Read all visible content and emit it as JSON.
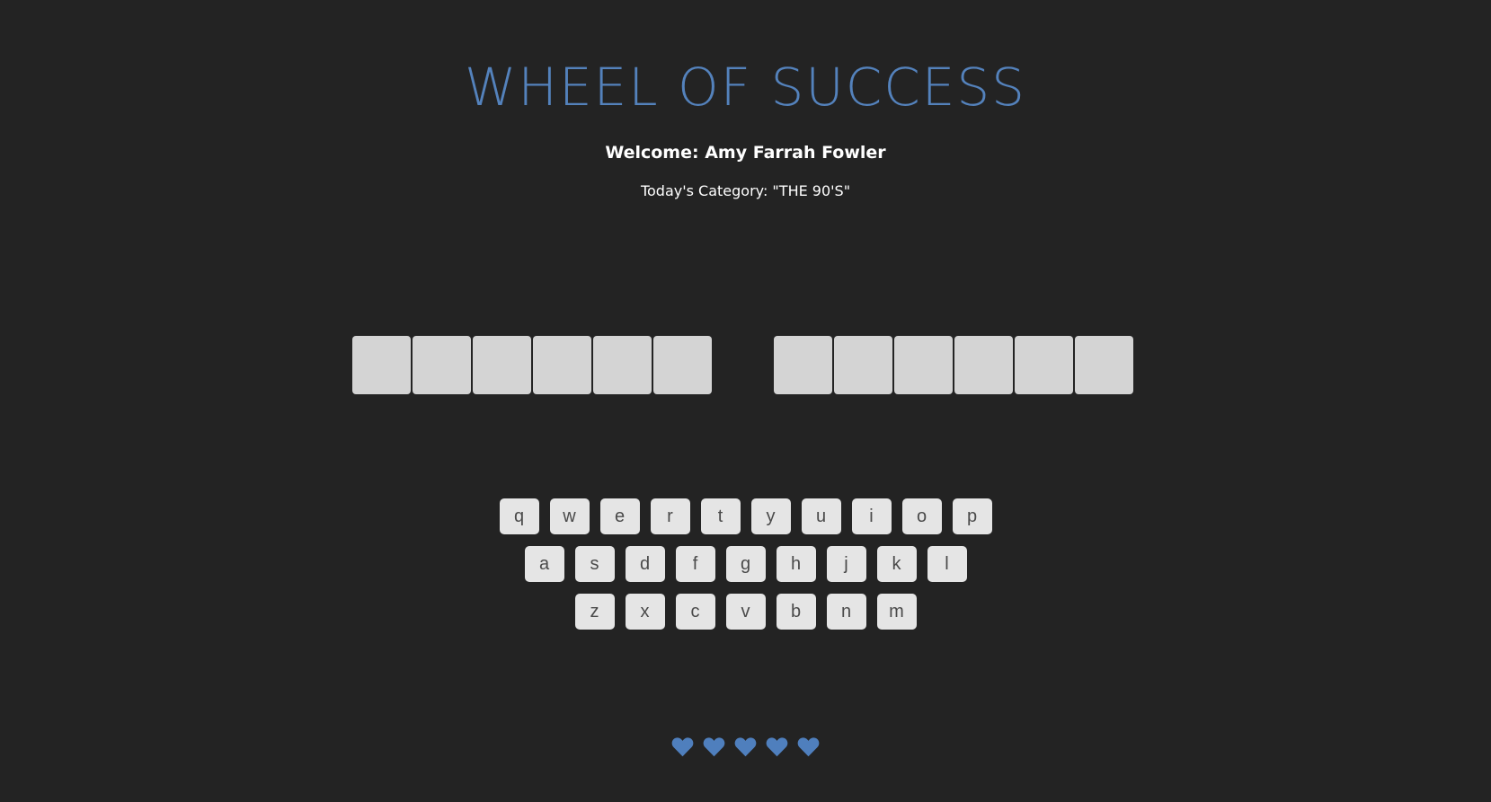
{
  "header": {
    "title": "WHEEL OF SUCCESS",
    "welcome": "Welcome: Amy Farrah Fowler",
    "category": "Today's Category: \"THE 90'S\""
  },
  "phrase": {
    "word_lengths": [
      6,
      6
    ]
  },
  "keyboard": {
    "rows": [
      [
        "q",
        "w",
        "e",
        "r",
        "t",
        "y",
        "u",
        "i",
        "o",
        "p"
      ],
      [
        "a",
        "s",
        "d",
        "f",
        "g",
        "h",
        "j",
        "k",
        "l"
      ],
      [
        "z",
        "x",
        "c",
        "v",
        "b",
        "n",
        "m"
      ]
    ]
  },
  "lives": {
    "count": 5,
    "icon": "heart-icon",
    "color": "#4f7fbd"
  },
  "colors": {
    "background": "#232323",
    "title": "#5482bc",
    "tile": "#d4d4d4",
    "key": "#e5e5e5"
  }
}
